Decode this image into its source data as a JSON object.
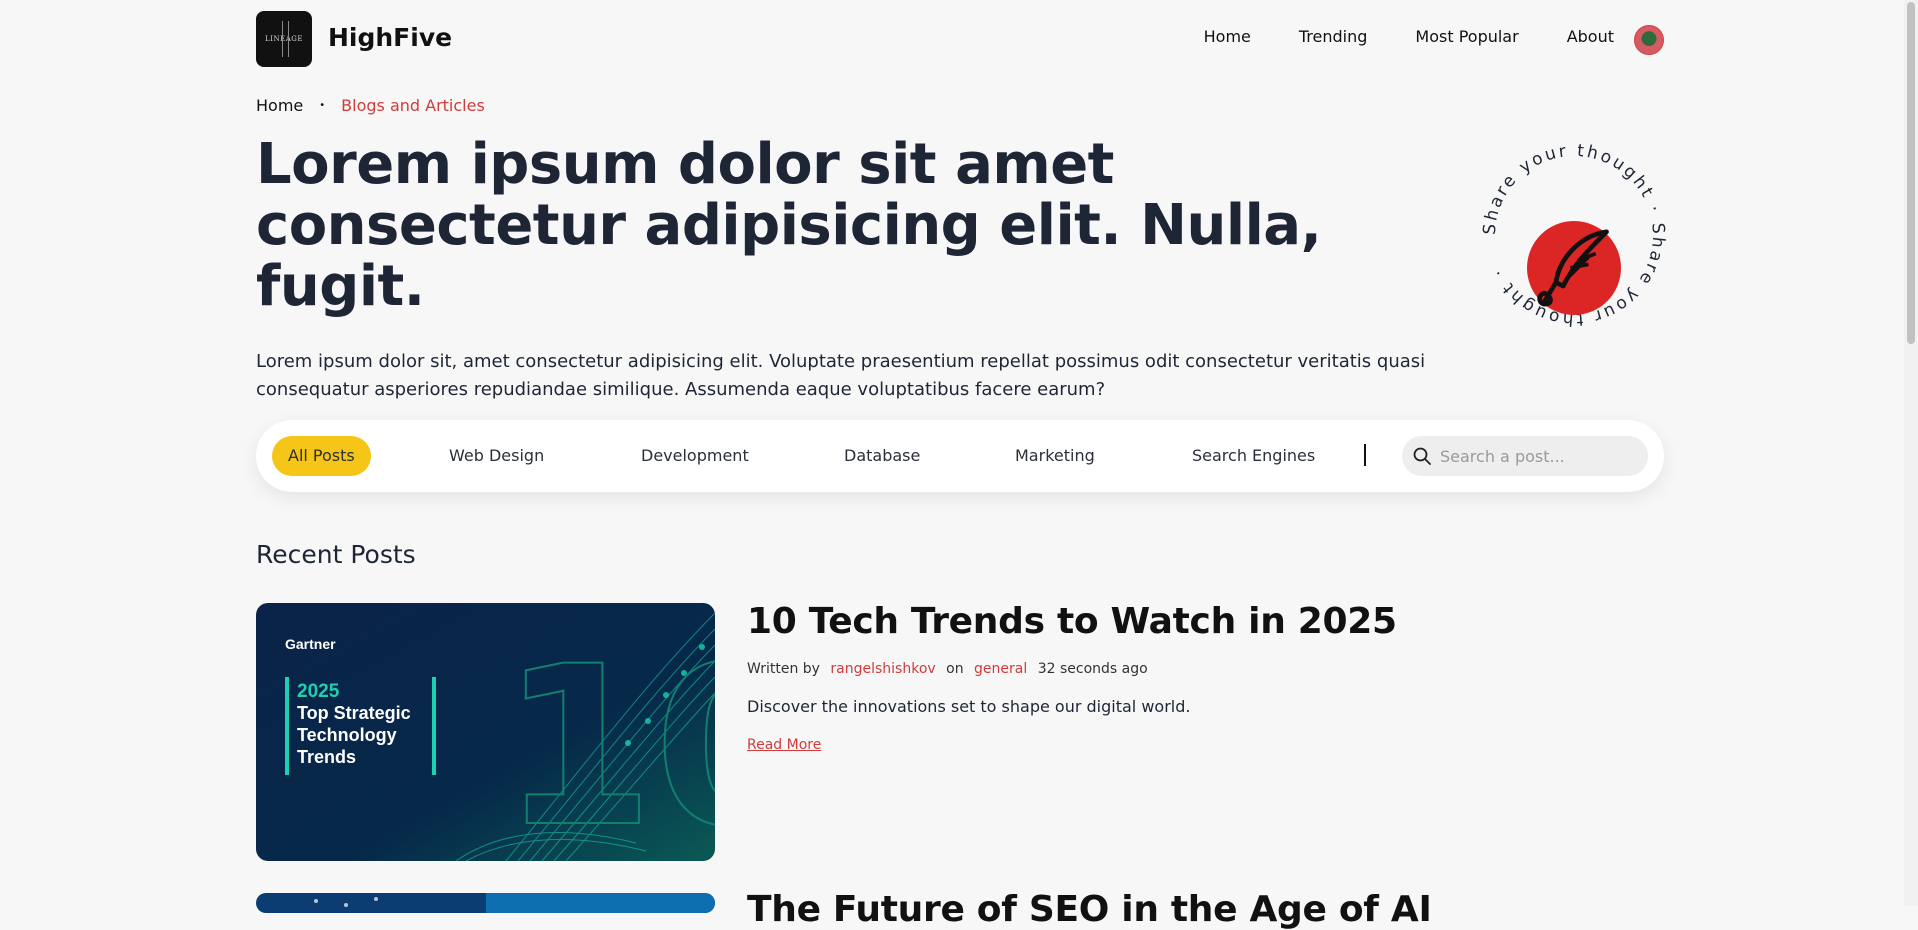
{
  "header": {
    "logo_text": "Lineage",
    "brand": "HighFive",
    "nav": [
      "Home",
      "Trending",
      "Most Popular",
      "About"
    ],
    "avatar_icon": "user-avatar"
  },
  "breadcrumb": {
    "home": "Home",
    "separator": "•",
    "current": "Blogs and Articles"
  },
  "hero": {
    "title": "Lorem ipsum dolor sit amet consectetur adipisicing elit. Nulla, fugit.",
    "intro": "Lorem ipsum dolor sit, amet consectetur adipisicing elit. Voluptate praesentium repellat possimus odit consectetur veritatis quasi consequatur asperiores repudiandae similique. Assumenda eaque voluptatibus facere earum?"
  },
  "share": {
    "ring_text": "Share your thought · Share your thought ·",
    "icon": "quill-pen-icon",
    "color": "#dc2626"
  },
  "filters": {
    "categories": [
      "All Posts",
      "Web Design",
      "Development",
      "Database",
      "Marketing",
      "Search Engines"
    ],
    "active": "All Posts",
    "search_placeholder": "Search a post...",
    "accent": "#f5c518"
  },
  "recent": {
    "heading": "Recent Posts",
    "posts": [
      {
        "title": "10 Tech Trends to Watch in 2025",
        "written_by": "Written by",
        "author": "rangelshishkov",
        "on": "on",
        "category": "general",
        "time": "32 seconds ago",
        "description": "Discover the innovations set to shape our digital world.",
        "read_more": "Read More",
        "image": {
          "brand": "Gartner",
          "year": "2025",
          "lines": [
            "Top Strategic",
            "Technology",
            "Trends"
          ],
          "big_number": "10"
        }
      },
      {
        "title": "The Future of SEO in the Age of AI"
      }
    ]
  },
  "colors": {
    "link_red": "#d23b3b",
    "text_dark": "#1e2636",
    "background": "#f7f7f7"
  }
}
